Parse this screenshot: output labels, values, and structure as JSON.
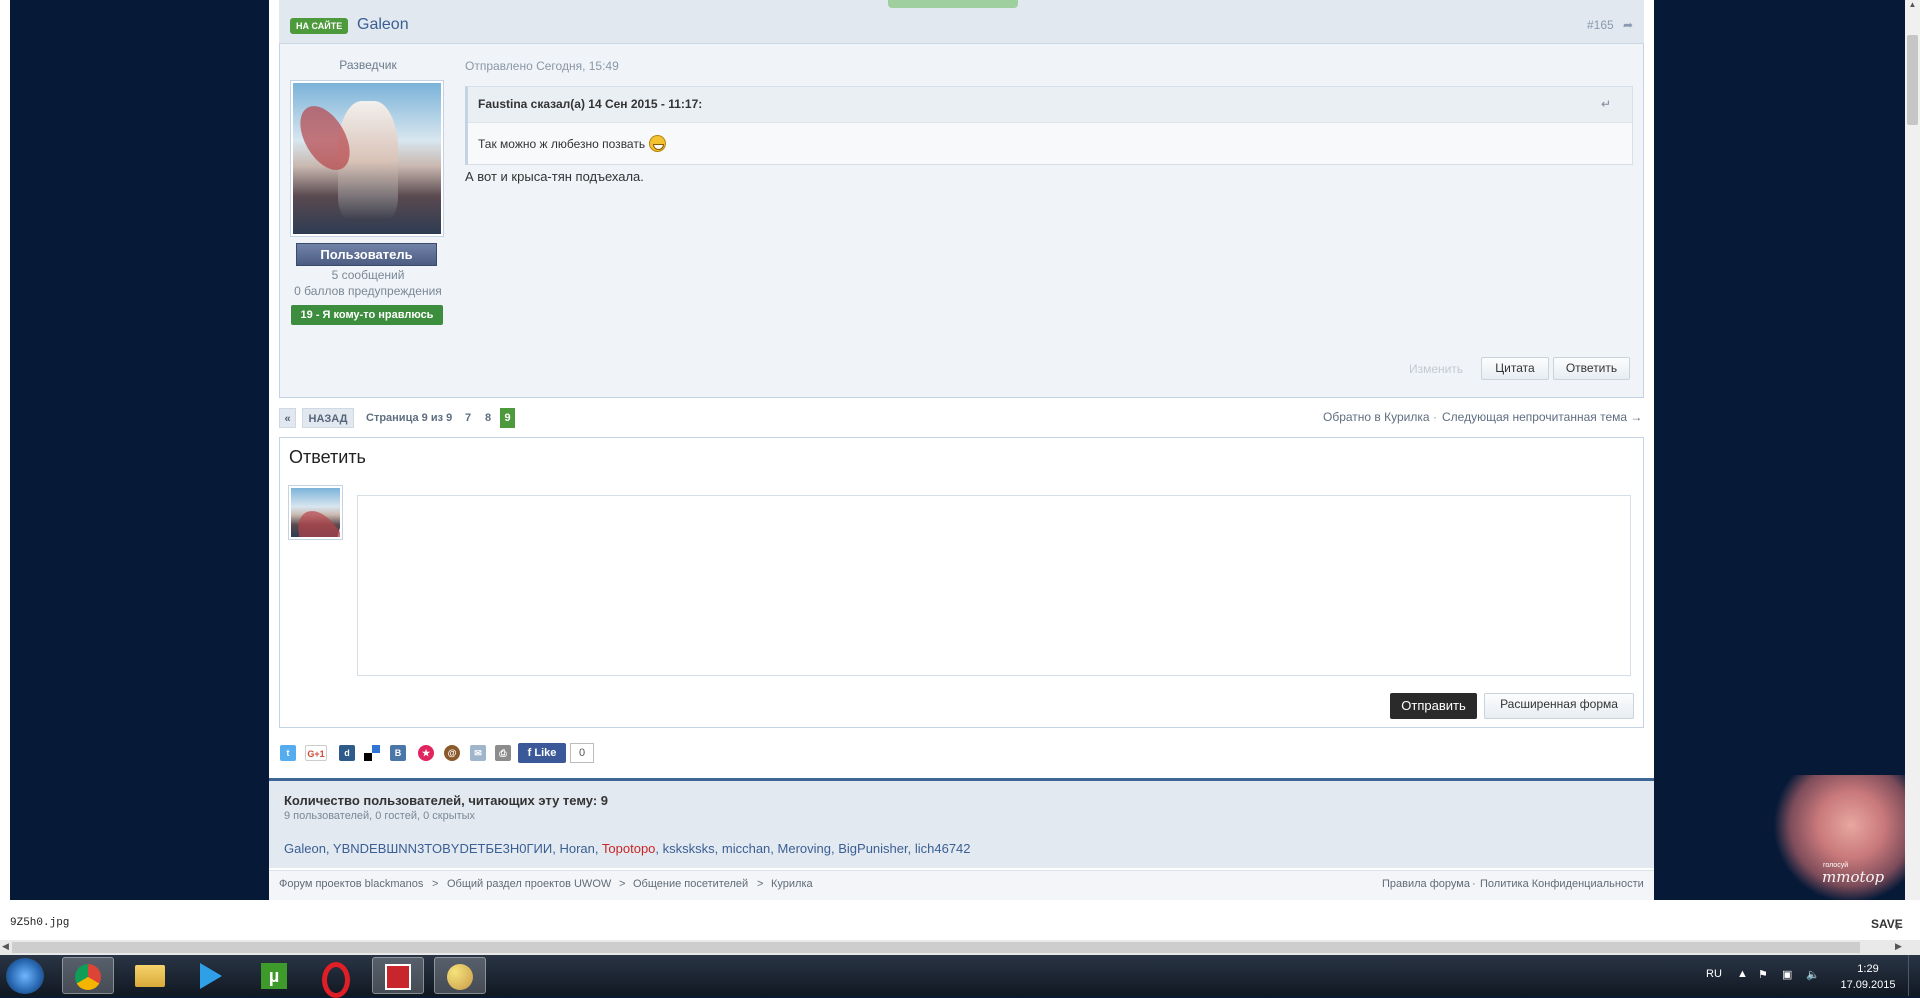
{
  "post": {
    "onsite_badge": "НА САЙТЕ",
    "username": "Galeon",
    "post_number": "#165",
    "user_title": "Разведчик",
    "role": "Пользователь",
    "messages": "5 сообщений",
    "warnings": "0 баллов предупреждения",
    "likes": "19 - Я кому-то нравлюсь",
    "sent": "Отправлено Сегодня, 15:49",
    "quote_author": "Faustina сказал(а) 14 Сен 2015 - 11:17:",
    "quote_text": "Так можно ж любезно позвать",
    "message": "А вот и крыса-тян подъехала.",
    "edit_label": "Изменить",
    "quote_button": "Цитата",
    "reply_button": "Ответить"
  },
  "pagination": {
    "prev_icon": "«",
    "back_label": "НАЗАД",
    "page_info": "Страница 9 из 9",
    "pages": [
      "7",
      "8",
      "9"
    ],
    "current": "9",
    "back_to": "Обратно в Курилка",
    "separator": "·",
    "next_unread": "Следующая непрочитанная тема →"
  },
  "reply": {
    "title": "Ответить",
    "send_button": "Отправить",
    "advanced_button": "Расширенная форма"
  },
  "share": {
    "fb_like": "Like",
    "fb_count": "0"
  },
  "readers": {
    "title": "Количество пользователей, читающих эту тему: 9",
    "subtitle": "9 пользователей, 0 гостей, 0 скрытых",
    "users": [
      "Galeon",
      "YBNDEBШNN3TOBYDETБE3H0ГИИ",
      "Horan",
      "Topotopo",
      "kskskskѕ",
      "micchan",
      "Meroving",
      "BigPunisher",
      "lich46742"
    ],
    "highlighted": "Topotopo"
  },
  "breadcrumbs": {
    "items": [
      "Форум проектов blackmanos",
      "Общий раздел проектов UWOW",
      "Общение посетителей",
      "Курилка"
    ],
    "separator": ">",
    "rules": "Правила форума",
    "privacy": "Политика Конфиденциальности"
  },
  "mascot": {
    "vote_text": "голосуй",
    "logo_text": "mmotop"
  },
  "viewer": {
    "filename": "9Z5h0.jpg",
    "save": "SAVE"
  },
  "taskbar": {
    "lang": "RU",
    "time": "1:29",
    "date": "17.09.2015",
    "apps": [
      "start-orb-icon",
      "chrome-icon",
      "explorer-icon",
      "media-player-icon",
      "utorrent-icon",
      "opera-icon",
      "screenshot-app-icon",
      "paint-icon"
    ]
  },
  "colors": {
    "page_bg": "#061a38",
    "accent_green": "#4d9a3c",
    "link_blue": "#3a5f94",
    "highlight_red": "#c62626"
  }
}
